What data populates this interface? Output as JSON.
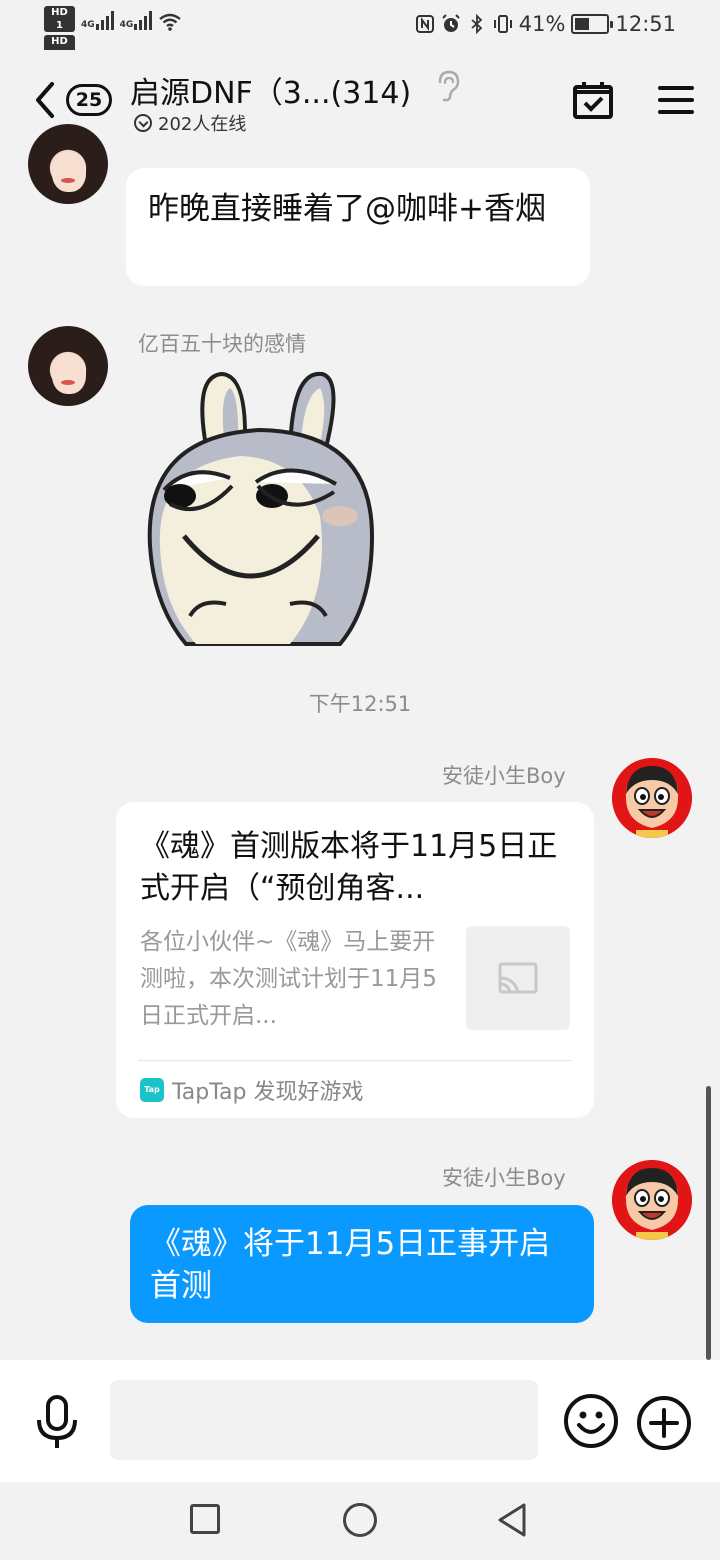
{
  "status_bar": {
    "hd1": "HD 1",
    "hd2": "HD 2",
    "net1": "4G",
    "net2": "4G",
    "battery_percent": "41%",
    "time": "12:51"
  },
  "header": {
    "unread_badge": "25",
    "title": "启源DNF（3...(314)",
    "online": "202人在线"
  },
  "messages": [
    {
      "text": "昨晚直接睡着了@咖啡+香烟"
    },
    {
      "sender": "亿百五十块的感情",
      "sticker": "rabbit-smirk-sticker"
    }
  ],
  "timestamp": "下午12:51",
  "link_message": {
    "sender": "安徒小生Boy",
    "title": "《魂》首测版本将于11月5日正式开启（“预创角客...",
    "description": "各位小伙伴~《魂》马上要开测啦，本次测试计划于11月5日正式开启...",
    "source_logo": "Tap",
    "source": "TapTap 发现好游戏"
  },
  "own_message": {
    "sender": "安徒小生Boy",
    "text": "《魂》将于11月5日正事开启首测"
  },
  "input": {
    "placeholder": ""
  },
  "colors": {
    "bubble_blue": "#0a99ff",
    "background": "#f2f2f2",
    "avatar_red": "#e11515"
  }
}
